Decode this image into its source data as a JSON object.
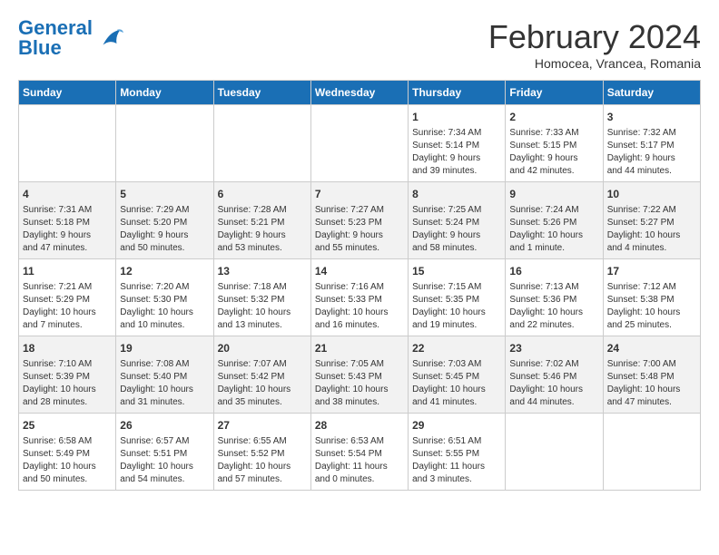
{
  "logo": {
    "text_general": "General",
    "text_blue": "Blue"
  },
  "header": {
    "month_year": "February 2024",
    "location": "Homocea, Vrancea, Romania"
  },
  "weekdays": [
    "Sunday",
    "Monday",
    "Tuesday",
    "Wednesday",
    "Thursday",
    "Friday",
    "Saturday"
  ],
  "weeks": [
    [
      {
        "day": "",
        "info": ""
      },
      {
        "day": "",
        "info": ""
      },
      {
        "day": "",
        "info": ""
      },
      {
        "day": "",
        "info": ""
      },
      {
        "day": "1",
        "info": "Sunrise: 7:34 AM\nSunset: 5:14 PM\nDaylight: 9 hours\nand 39 minutes."
      },
      {
        "day": "2",
        "info": "Sunrise: 7:33 AM\nSunset: 5:15 PM\nDaylight: 9 hours\nand 42 minutes."
      },
      {
        "day": "3",
        "info": "Sunrise: 7:32 AM\nSunset: 5:17 PM\nDaylight: 9 hours\nand 44 minutes."
      }
    ],
    [
      {
        "day": "4",
        "info": "Sunrise: 7:31 AM\nSunset: 5:18 PM\nDaylight: 9 hours\nand 47 minutes."
      },
      {
        "day": "5",
        "info": "Sunrise: 7:29 AM\nSunset: 5:20 PM\nDaylight: 9 hours\nand 50 minutes."
      },
      {
        "day": "6",
        "info": "Sunrise: 7:28 AM\nSunset: 5:21 PM\nDaylight: 9 hours\nand 53 minutes."
      },
      {
        "day": "7",
        "info": "Sunrise: 7:27 AM\nSunset: 5:23 PM\nDaylight: 9 hours\nand 55 minutes."
      },
      {
        "day": "8",
        "info": "Sunrise: 7:25 AM\nSunset: 5:24 PM\nDaylight: 9 hours\nand 58 minutes."
      },
      {
        "day": "9",
        "info": "Sunrise: 7:24 AM\nSunset: 5:26 PM\nDaylight: 10 hours\nand 1 minute."
      },
      {
        "day": "10",
        "info": "Sunrise: 7:22 AM\nSunset: 5:27 PM\nDaylight: 10 hours\nand 4 minutes."
      }
    ],
    [
      {
        "day": "11",
        "info": "Sunrise: 7:21 AM\nSunset: 5:29 PM\nDaylight: 10 hours\nand 7 minutes."
      },
      {
        "day": "12",
        "info": "Sunrise: 7:20 AM\nSunset: 5:30 PM\nDaylight: 10 hours\nand 10 minutes."
      },
      {
        "day": "13",
        "info": "Sunrise: 7:18 AM\nSunset: 5:32 PM\nDaylight: 10 hours\nand 13 minutes."
      },
      {
        "day": "14",
        "info": "Sunrise: 7:16 AM\nSunset: 5:33 PM\nDaylight: 10 hours\nand 16 minutes."
      },
      {
        "day": "15",
        "info": "Sunrise: 7:15 AM\nSunset: 5:35 PM\nDaylight: 10 hours\nand 19 minutes."
      },
      {
        "day": "16",
        "info": "Sunrise: 7:13 AM\nSunset: 5:36 PM\nDaylight: 10 hours\nand 22 minutes."
      },
      {
        "day": "17",
        "info": "Sunrise: 7:12 AM\nSunset: 5:38 PM\nDaylight: 10 hours\nand 25 minutes."
      }
    ],
    [
      {
        "day": "18",
        "info": "Sunrise: 7:10 AM\nSunset: 5:39 PM\nDaylight: 10 hours\nand 28 minutes."
      },
      {
        "day": "19",
        "info": "Sunrise: 7:08 AM\nSunset: 5:40 PM\nDaylight: 10 hours\nand 31 minutes."
      },
      {
        "day": "20",
        "info": "Sunrise: 7:07 AM\nSunset: 5:42 PM\nDaylight: 10 hours\nand 35 minutes."
      },
      {
        "day": "21",
        "info": "Sunrise: 7:05 AM\nSunset: 5:43 PM\nDaylight: 10 hours\nand 38 minutes."
      },
      {
        "day": "22",
        "info": "Sunrise: 7:03 AM\nSunset: 5:45 PM\nDaylight: 10 hours\nand 41 minutes."
      },
      {
        "day": "23",
        "info": "Sunrise: 7:02 AM\nSunset: 5:46 PM\nDaylight: 10 hours\nand 44 minutes."
      },
      {
        "day": "24",
        "info": "Sunrise: 7:00 AM\nSunset: 5:48 PM\nDaylight: 10 hours\nand 47 minutes."
      }
    ],
    [
      {
        "day": "25",
        "info": "Sunrise: 6:58 AM\nSunset: 5:49 PM\nDaylight: 10 hours\nand 50 minutes."
      },
      {
        "day": "26",
        "info": "Sunrise: 6:57 AM\nSunset: 5:51 PM\nDaylight: 10 hours\nand 54 minutes."
      },
      {
        "day": "27",
        "info": "Sunrise: 6:55 AM\nSunset: 5:52 PM\nDaylight: 10 hours\nand 57 minutes."
      },
      {
        "day": "28",
        "info": "Sunrise: 6:53 AM\nSunset: 5:54 PM\nDaylight: 11 hours\nand 0 minutes."
      },
      {
        "day": "29",
        "info": "Sunrise: 6:51 AM\nSunset: 5:55 PM\nDaylight: 11 hours\nand 3 minutes."
      },
      {
        "day": "",
        "info": ""
      },
      {
        "day": "",
        "info": ""
      }
    ]
  ]
}
